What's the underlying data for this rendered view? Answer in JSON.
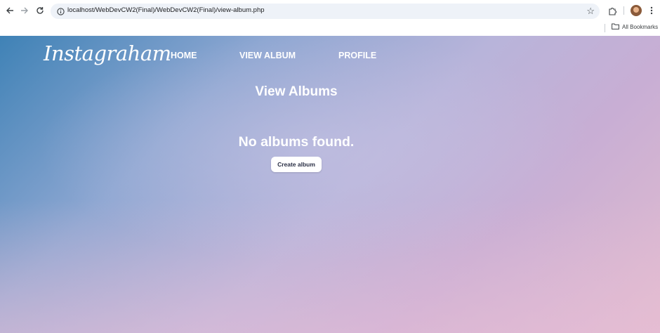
{
  "browser": {
    "url": "localhost/WebDevCW2(Final)/WebDevCW2(Final)/view-album.php",
    "bookmarks_label": "All Bookmarks",
    "icons": {
      "back": "back-arrow-icon",
      "forward": "forward-arrow-icon",
      "reload": "reload-icon",
      "site_info": "site-info-icon",
      "bookmark_star": "star-icon",
      "extensions": "puzzle-icon",
      "menu": "kebab-menu-icon",
      "bookmarks_folder": "folder-icon"
    }
  },
  "site": {
    "logo": "Instagraham",
    "nav": [
      {
        "label": "HOME"
      },
      {
        "label": "VIEW ALBUM"
      },
      {
        "label": "PROFILE"
      }
    ]
  },
  "main": {
    "title": "View Albums",
    "empty_message": "No albums found.",
    "create_button_label": "Create album"
  },
  "colors": {
    "gradient_top_left": "#3f82b6",
    "gradient_bottom_right": "#e2bccf",
    "text": "#ffffff",
    "button_bg": "#ffffff"
  }
}
